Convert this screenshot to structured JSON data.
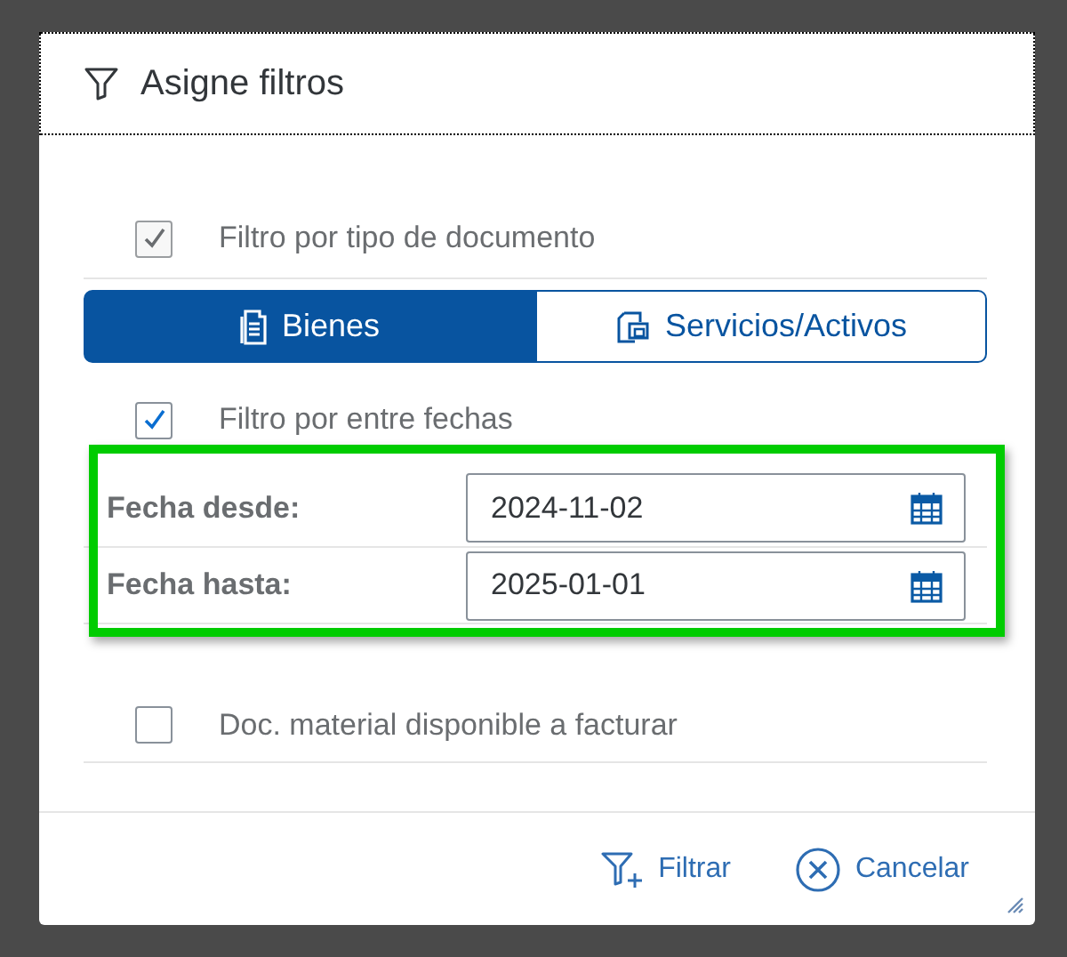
{
  "dialog": {
    "title": "Asigne filtros"
  },
  "rows": [
    {
      "kind": "checkbox",
      "label": "Filtro por tipo de documento",
      "checked": true,
      "disabled": true
    },
    {
      "kind": "segmented",
      "options": [
        {
          "label": "Bienes",
          "selected": true
        },
        {
          "label": "Servicios/Activos",
          "selected": false
        }
      ]
    },
    {
      "kind": "checkbox",
      "label": "Filtro por entre fechas",
      "checked": true,
      "disabled": false
    },
    {
      "kind": "dates",
      "highlighted": true,
      "fields": [
        {
          "label": "Fecha desde:",
          "value": "2024-11-02"
        },
        {
          "label": "Fecha hasta:",
          "value": "2025-01-01"
        }
      ]
    },
    {
      "kind": "checkbox",
      "label": "Doc. material disponible a facturar",
      "checked": false,
      "disabled": false
    }
  ],
  "footer": {
    "buttons": [
      {
        "kind": "filter",
        "label": "Filtrar"
      },
      {
        "kind": "cancel",
        "label": "Cancelar"
      }
    ]
  }
}
